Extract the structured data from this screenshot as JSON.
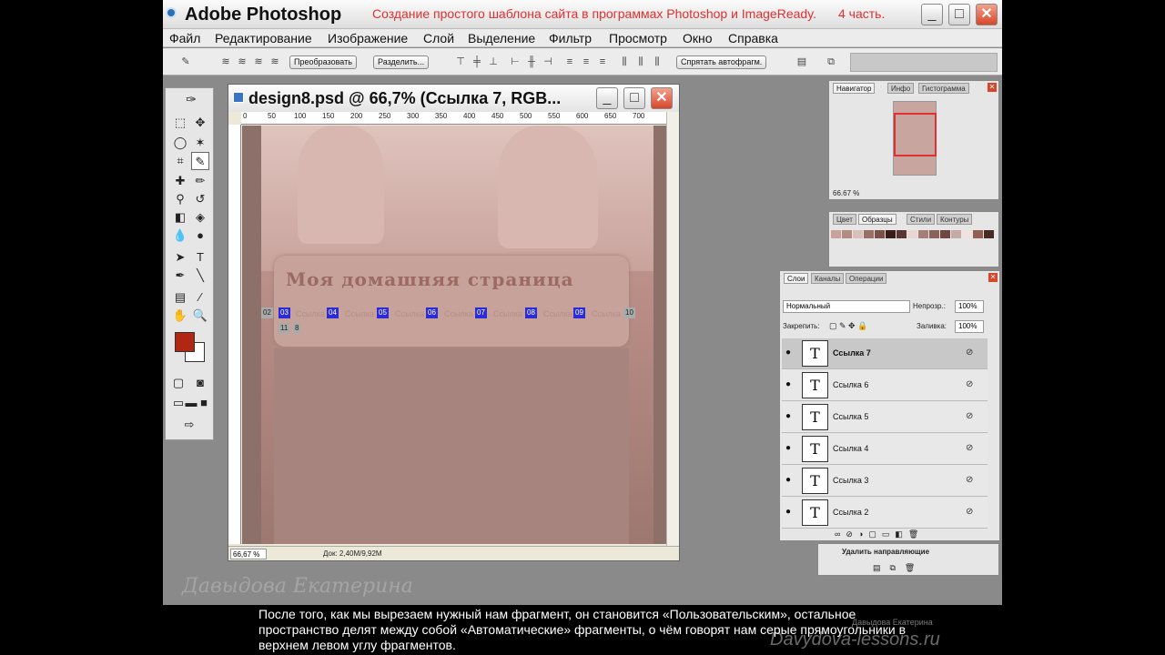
{
  "window": {
    "app_title": "Adobe Photoshop",
    "video_title": "Создание простого шаблона сайта в программах Photoshop и ImageReady.",
    "video_part": "4 часть.",
    "minimize": "_",
    "maximize": "□",
    "close": "✕"
  },
  "menu": [
    "Файл",
    "Редактирование",
    "Изображение",
    "Слой",
    "Выделение",
    "Фильтр",
    "Просмотр",
    "Окно",
    "Справка"
  ],
  "options_bar": {
    "btn_convert": "Преобразовать",
    "btn_divide": "Разделить...",
    "btn_hide_auto": "Спрятать автофрагм."
  },
  "document": {
    "title": "design8.psd @ 66,7% (Ссылка 7, RGB...",
    "ruler_h": [
      "0",
      "50",
      "100",
      "150",
      "200",
      "250",
      "300",
      "350",
      "400",
      "450",
      "500",
      "550",
      "600",
      "650",
      "700"
    ],
    "heading": "Моя домашняя страница",
    "slice_tags": [
      "02",
      "03",
      "04",
      "05",
      "06",
      "07",
      "08",
      "09",
      "10",
      "11",
      "8"
    ],
    "links": [
      "Ссылка 1",
      "Ссылка 2",
      "Ссылка 3",
      "Ссылка 4",
      "Ссылка 5",
      "Ссылка 6",
      "Ссылка 7"
    ],
    "zoom": "66,67 %",
    "doc_size": "Док: 2,40М/9,92М"
  },
  "navigator": {
    "tabs": [
      "Навигатор",
      "Инфо",
      "Гистограмма"
    ],
    "zoom": "66.67 %"
  },
  "swatches": {
    "tabs": [
      "Цвет",
      "Образцы",
      "Стили",
      "Контуры"
    ],
    "colors": [
      "#c9a29b",
      "#b48a83",
      "#d8c0bb",
      "#9a6f68",
      "#7a5049",
      "#3a1c18",
      "#5b3530",
      "#e8d6d2",
      "#a67e77",
      "#8b625b",
      "#6d4740",
      "#c4aaa5",
      "#f0e2df",
      "#935e55",
      "#4a2a25"
    ]
  },
  "layers": {
    "tabs": [
      "Слои",
      "Каналы",
      "Операции"
    ],
    "blend_mode": "Нормальный",
    "opacity_label": "Непрозр.:",
    "opacity": "100%",
    "lock_label": "Закрепить:",
    "fill_label": "Заливка:",
    "fill": "100%",
    "items": [
      "Ссылка 7",
      "Ссылка 6",
      "Ссылка 5",
      "Ссылка 4",
      "Ссылка 3",
      "Ссылка 2"
    ]
  },
  "history": {
    "item": "Удалить направляющие"
  },
  "caption": {
    "watermark_left": "Давыдова Екатерина",
    "watermark_right": "Davydova-lessons.ru",
    "watermark_small": "Давыдова Екатерина",
    "text": "После того, как мы вырезаем нужный нам фрагмент, он становится «Пользовательским», остальное пространство делят между собой «Автоматические» фрагменты, о чём говорят нам серые прямоугольники в верхнем левом углу фрагментов."
  }
}
